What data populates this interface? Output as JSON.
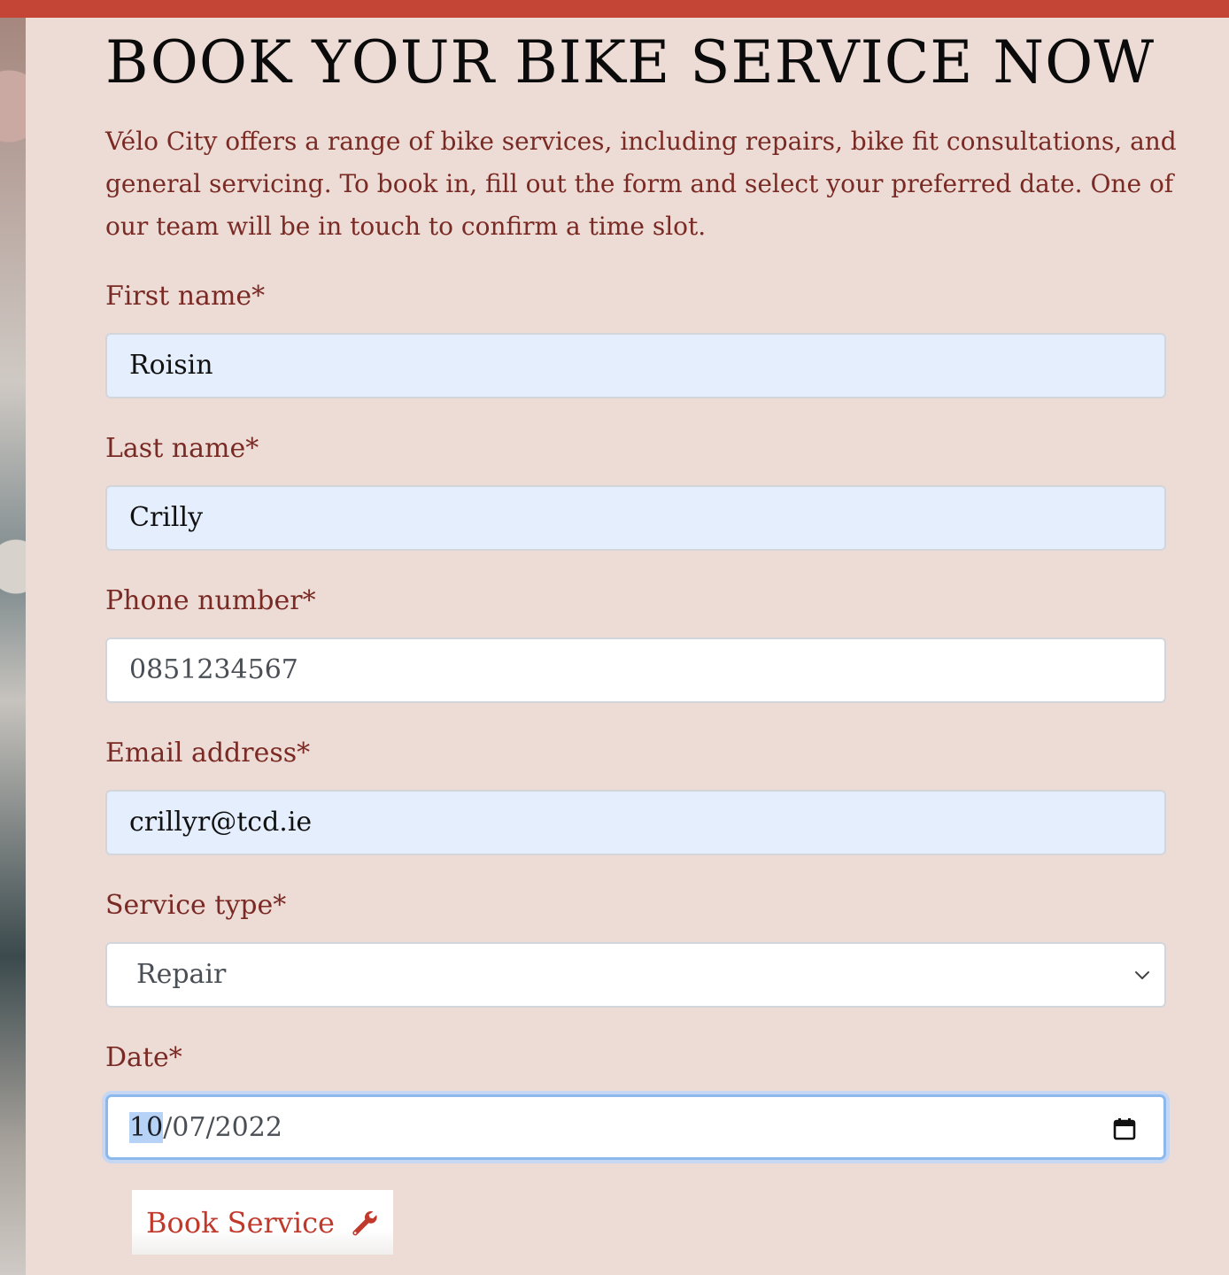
{
  "page": {
    "heading": "BOOK YOUR BIKE SERVICE NOW",
    "intro": "Vélo City offers a range of bike services, including repairs, bike fit consultations, and general servicing. To book in, fill out the form and select your preferred date. One of our team will be in touch to confirm a time slot."
  },
  "form": {
    "first_name": {
      "label": "First name*",
      "value": "Roisin"
    },
    "last_name": {
      "label": "Last name*",
      "value": "Crilly"
    },
    "phone": {
      "label": "Phone number*",
      "value": "0851234567"
    },
    "email": {
      "label": "Email address*",
      "value": "crillyr@tcd.ie"
    },
    "service_type": {
      "label": "Service type*",
      "value": "Repair"
    },
    "date": {
      "label": "Date*",
      "day": "10",
      "rest": "/07/2022"
    },
    "submit": {
      "label": "Book Service",
      "icon": "wrench-icon"
    }
  },
  "colors": {
    "accent": "#c44536",
    "label": "#7a2a24",
    "panel": "#eddcd5",
    "autofill": "#e4eefd"
  }
}
